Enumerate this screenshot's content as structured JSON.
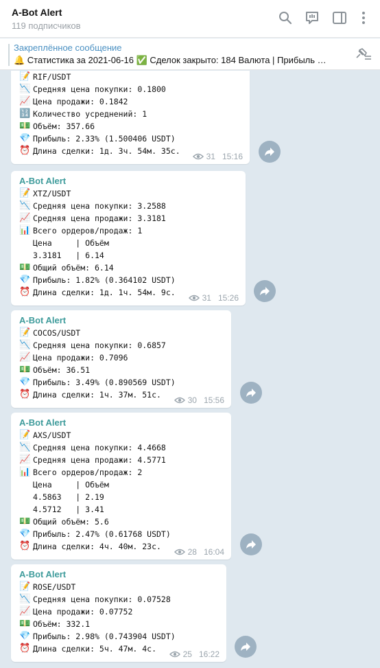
{
  "header": {
    "title": "A-Bot Alert",
    "subtitle": "119 подписчиков"
  },
  "pinned": {
    "title": "Закреплённое сообщение",
    "text": "🔔 Статистика за 2021-06-16 ✅ Сделок закрыто: 184    Валюта | Прибыль   …"
  },
  "messages": [
    {
      "sender": "",
      "lines": [
        {
          "icon": "memo-icon",
          "glyph": "📝",
          "text": "RIF/USDT"
        },
        {
          "icon": "chart-decreasing-icon",
          "glyph": "📉",
          "text": "Средняя цена покупки: 0.1800"
        },
        {
          "icon": "chart-increasing-icon",
          "glyph": "📈",
          "text": "Цена продажи: 0.1842"
        },
        {
          "icon": "numbers-1234-icon",
          "glyph": "🔢",
          "text": "Количество усреднений: 1"
        },
        {
          "icon": "money-icon",
          "glyph": "💵",
          "text": "Объём: 357.66"
        },
        {
          "icon": "diamond-icon",
          "glyph": "💎",
          "text": "Прибыль: 2.33% (1.500406 USDT)"
        },
        {
          "icon": "alarm-clock-icon",
          "glyph": "⏰",
          "text": "Длина сделки: 1д. 3ч. 54м. 35с."
        }
      ],
      "views": "31",
      "time": "15:16"
    },
    {
      "sender": "A-Bot Alert",
      "lines": [
        {
          "icon": "memo-icon",
          "glyph": "📝",
          "text": "XTZ/USDT"
        },
        {
          "icon": "chart-decreasing-icon",
          "glyph": "📉",
          "text": "Средняя цена покупки: 3.2588"
        },
        {
          "icon": "chart-increasing-icon",
          "glyph": "📈",
          "text": "Средняя цена продажи: 3.3181"
        },
        {
          "icon": "bar-chart-icon",
          "glyph": "📊",
          "text": "Всего ордеров/продаж: 1"
        },
        {
          "icon": "",
          "glyph": "",
          "text": "Цена     | Объём"
        },
        {
          "icon": "",
          "glyph": "",
          "text": "3.3181   | 6.14"
        },
        {
          "icon": "money-icon",
          "glyph": "💵",
          "text": "Общий объём: 6.14"
        },
        {
          "icon": "diamond-icon",
          "glyph": "💎",
          "text": "Прибыль: 1.82% (0.364102 USDT)"
        },
        {
          "icon": "alarm-clock-icon",
          "glyph": "⏰",
          "text": "Длина сделки: 1д. 1ч. 54м. 9с."
        }
      ],
      "views": "31",
      "time": "15:26"
    },
    {
      "sender": "A-Bot Alert",
      "lines": [
        {
          "icon": "memo-icon",
          "glyph": "📝",
          "text": "COCOS/USDT"
        },
        {
          "icon": "chart-decreasing-icon",
          "glyph": "📉",
          "text": "Средняя цена покупки: 0.6857"
        },
        {
          "icon": "chart-increasing-icon",
          "glyph": "📈",
          "text": "Цена продажи: 0.7096"
        },
        {
          "icon": "money-icon",
          "glyph": "💵",
          "text": "Объём: 36.51"
        },
        {
          "icon": "diamond-icon",
          "glyph": "💎",
          "text": "Прибыль: 3.49% (0.890569 USDT)"
        },
        {
          "icon": "alarm-clock-icon",
          "glyph": "⏰",
          "text": "Длина сделки: 1ч. 37м. 51с."
        }
      ],
      "views": "30",
      "time": "15:56"
    },
    {
      "sender": "A-Bot Alert",
      "lines": [
        {
          "icon": "memo-icon",
          "glyph": "📝",
          "text": "AXS/USDT"
        },
        {
          "icon": "chart-decreasing-icon",
          "glyph": "📉",
          "text": "Средняя цена покупки: 4.4668"
        },
        {
          "icon": "chart-increasing-icon",
          "glyph": "📈",
          "text": "Средняя цена продажи: 4.5771"
        },
        {
          "icon": "bar-chart-icon",
          "glyph": "📊",
          "text": "Всего ордеров/продаж: 2"
        },
        {
          "icon": "",
          "glyph": "",
          "text": "Цена     | Объём"
        },
        {
          "icon": "",
          "glyph": "",
          "text": "4.5863   | 2.19"
        },
        {
          "icon": "",
          "glyph": "",
          "text": "4.5712   | 3.41"
        },
        {
          "icon": "money-icon",
          "glyph": "💵",
          "text": "Общий объём: 5.6"
        },
        {
          "icon": "diamond-icon",
          "glyph": "💎",
          "text": "Прибыль: 2.47% (0.61768 USDT)"
        },
        {
          "icon": "alarm-clock-icon",
          "glyph": "⏰",
          "text": "Длина сделки: 4ч. 40м. 23с."
        }
      ],
      "views": "28",
      "time": "16:04"
    },
    {
      "sender": "A-Bot Alert",
      "lines": [
        {
          "icon": "memo-icon",
          "glyph": "📝",
          "text": "ROSE/USDT"
        },
        {
          "icon": "chart-decreasing-icon",
          "glyph": "📉",
          "text": "Средняя цена покупки: 0.07528"
        },
        {
          "icon": "chart-increasing-icon",
          "glyph": "📈",
          "text": "Цена продажи: 0.07752"
        },
        {
          "icon": "money-icon",
          "glyph": "💵",
          "text": "Объём: 332.1"
        },
        {
          "icon": "diamond-icon",
          "glyph": "💎",
          "text": "Прибыль: 2.98% (0.743904 USDT)"
        },
        {
          "icon": "alarm-clock-icon",
          "glyph": "⏰",
          "text": "Длина сделки: 5ч. 47м. 4с."
        }
      ],
      "views": "25",
      "time": "16:22"
    }
  ]
}
